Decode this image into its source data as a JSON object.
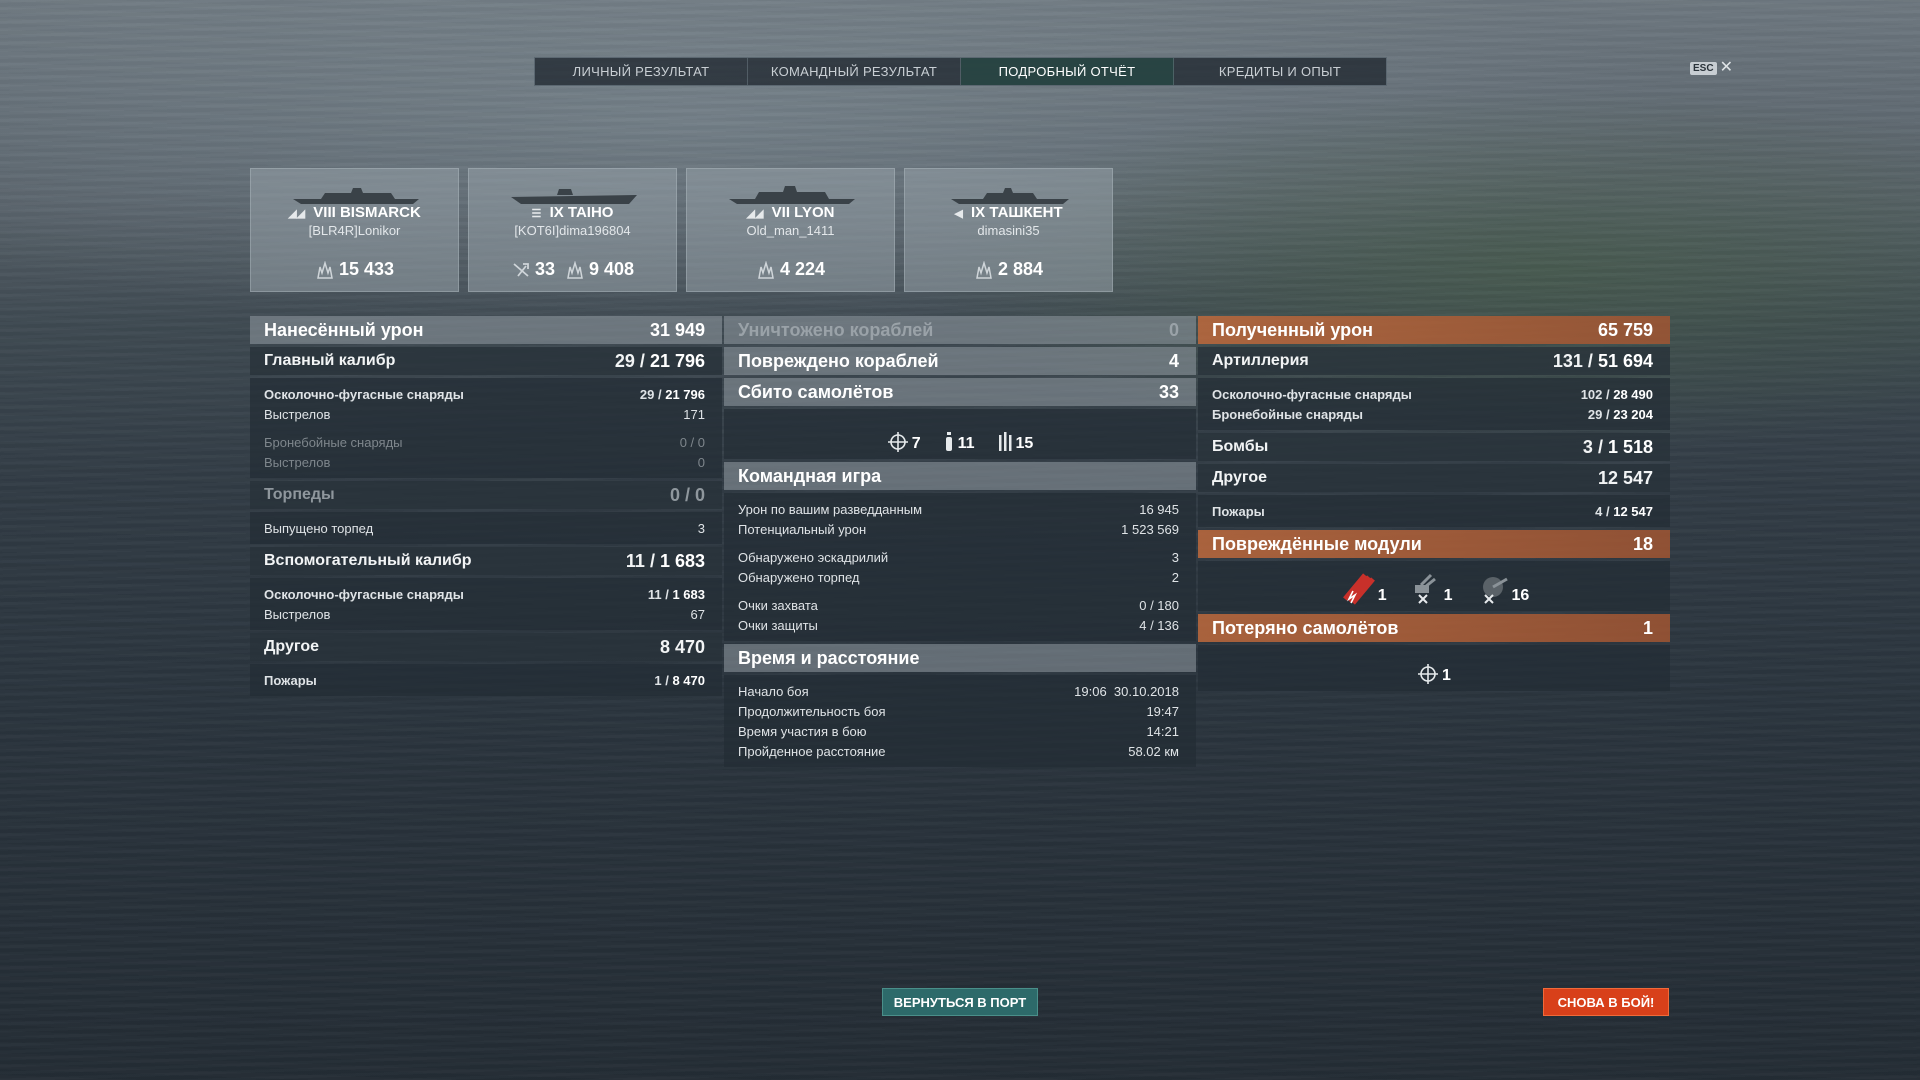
{
  "tabs": [
    {
      "label": "ЛИЧНЫЙ РЕЗУЛЬТАТ",
      "active": false
    },
    {
      "label": "КОМАНДНЫЙ РЕЗУЛЬТАТ",
      "active": false
    },
    {
      "label": "ПОДРОБНЫЙ ОТЧЁТ",
      "active": true
    },
    {
      "label": "КРЕДИТЫ И ОПЫТ",
      "active": false
    }
  ],
  "esc": {
    "key_label": "ESC",
    "close_glyph": "✕"
  },
  "ships": [
    {
      "tier": "VIII",
      "name": "BISMARCK",
      "player": "[BLR4R]Lonikor",
      "class_icon": "battleship-icon",
      "stats": [
        {
          "icon": "damage-icon",
          "value": "15 433"
        }
      ]
    },
    {
      "tier": "IX",
      "name": "TAIHO",
      "player": "[KOT6I]dima196804",
      "class_icon": "carrier-icon",
      "stats": [
        {
          "icon": "planes-shot-icon",
          "value": "33"
        },
        {
          "icon": "damage-icon",
          "value": "9 408"
        }
      ]
    },
    {
      "tier": "VII",
      "name": "LYON",
      "player": "Old_man_1411",
      "class_icon": "battleship-icon",
      "stats": [
        {
          "icon": "damage-icon",
          "value": "4 224"
        }
      ]
    },
    {
      "tier": "IX",
      "name": "ТАШКЕНТ",
      "player": "dimasini35",
      "class_icon": "destroyer-icon",
      "stats": [
        {
          "icon": "damage-icon",
          "value": "2 884"
        }
      ]
    }
  ],
  "dealt": {
    "header": {
      "label": "Нанесённый урон",
      "value": "31 949"
    },
    "main": {
      "label": "Главный калибр",
      "hits": "29",
      "dmg": "21 796"
    },
    "main_he": {
      "label": "Осколочно-фугасные снаряды",
      "hits": "29",
      "dmg": "21 796"
    },
    "main_he_shots": {
      "label": "Выстрелов",
      "value": "171"
    },
    "main_ap": {
      "label": "Бронебойные снаряды",
      "value": "0 / 0"
    },
    "main_ap_shots": {
      "label": "Выстрелов",
      "value": "0"
    },
    "torp": {
      "label": "Торпеды",
      "value": "0 / 0"
    },
    "torp_fired": {
      "label": "Выпущено торпед",
      "value": "3"
    },
    "sec": {
      "label": "Вспомогательный калибр",
      "hits": "11",
      "dmg": "1 683"
    },
    "sec_he": {
      "label": "Осколочно-фугасные снаряды",
      "hits": "11",
      "dmg": "1 683"
    },
    "sec_shots": {
      "label": "Выстрелов",
      "value": "67"
    },
    "other": {
      "label": "Другое",
      "value": "8 470"
    },
    "fires": {
      "label": "Пожары",
      "hits": "1",
      "dmg": "8 470"
    }
  },
  "middle": {
    "destroyed": {
      "label": "Уничтожено кораблей",
      "value": "0"
    },
    "damaged": {
      "label": "Повреждено кораблей",
      "value": "4"
    },
    "planes": {
      "label": "Сбито самолётов",
      "value": "33"
    },
    "plane_types": [
      {
        "icon": "fighter-icon",
        "value": "7"
      },
      {
        "icon": "bomber-icon",
        "value": "11"
      },
      {
        "icon": "torpedo-bomber-icon",
        "value": "15"
      }
    ],
    "team": {
      "label": "Командная игра"
    },
    "spot_dmg": {
      "label": "Урон по вашим разведданным",
      "value": "16 945"
    },
    "potential": {
      "label": "Потенциальный урон",
      "value": "1 523 569"
    },
    "spot_sq": {
      "label": "Обнаружено эскадрилий",
      "value": "3"
    },
    "spot_torp": {
      "label": "Обнаружено торпед",
      "value": "2"
    },
    "capture": {
      "label": "Очки захвата",
      "value": "0 / 180"
    },
    "defense": {
      "label": "Очки защиты",
      "value": "4 / 136"
    },
    "time": {
      "label": "Время и расстояние"
    },
    "start": {
      "label": "Начало боя",
      "value": "19:06  30.10.2018"
    },
    "duration": {
      "label": "Продолжительность боя",
      "value": "19:47"
    },
    "participation": {
      "label": "Время участия в бою",
      "value": "14:21"
    },
    "distance": {
      "label": "Пройденное расстояние",
      "value": "58.02 км"
    }
  },
  "received": {
    "header": {
      "label": "Полученный урон",
      "value": "65 759"
    },
    "art": {
      "label": "Артиллерия",
      "hits": "131",
      "dmg": "51 694"
    },
    "he": {
      "label": "Осколочно-фугасные снаряды",
      "hits": "102",
      "dmg": "28 490"
    },
    "ap": {
      "label": "Бронебойные снаряды",
      "hits": "29",
      "dmg": "23 204"
    },
    "bombs": {
      "label": "Бомбы",
      "hits": "3",
      "dmg": "1 518"
    },
    "other": {
      "label": "Другое",
      "value": "12 547"
    },
    "fires": {
      "label": "Пожары",
      "hits": "4",
      "dmg": "12 547"
    },
    "modules": {
      "label": "Повреждённые модули",
      "value": "18"
    },
    "module_types": [
      {
        "icon": "torpedo-tubes-icon",
        "value": "1"
      },
      {
        "icon": "aa-mount-icon",
        "value": "1"
      },
      {
        "icon": "secondary-gun-icon",
        "value": "16"
      }
    ],
    "lost": {
      "label": "Потеряно самолётов",
      "value": "1"
    },
    "lost_types": [
      {
        "icon": "fighter-icon",
        "value": "1"
      }
    ]
  },
  "buttons": {
    "port": "ВЕРНУТЬСЯ В ПОРТ",
    "battle": "СНОВА В БОЙ!"
  },
  "colors": {
    "active_tab": "#284644",
    "received_header": "#be693c",
    "battle_button": "#d8401a",
    "port_button": "#2d6a6a"
  }
}
